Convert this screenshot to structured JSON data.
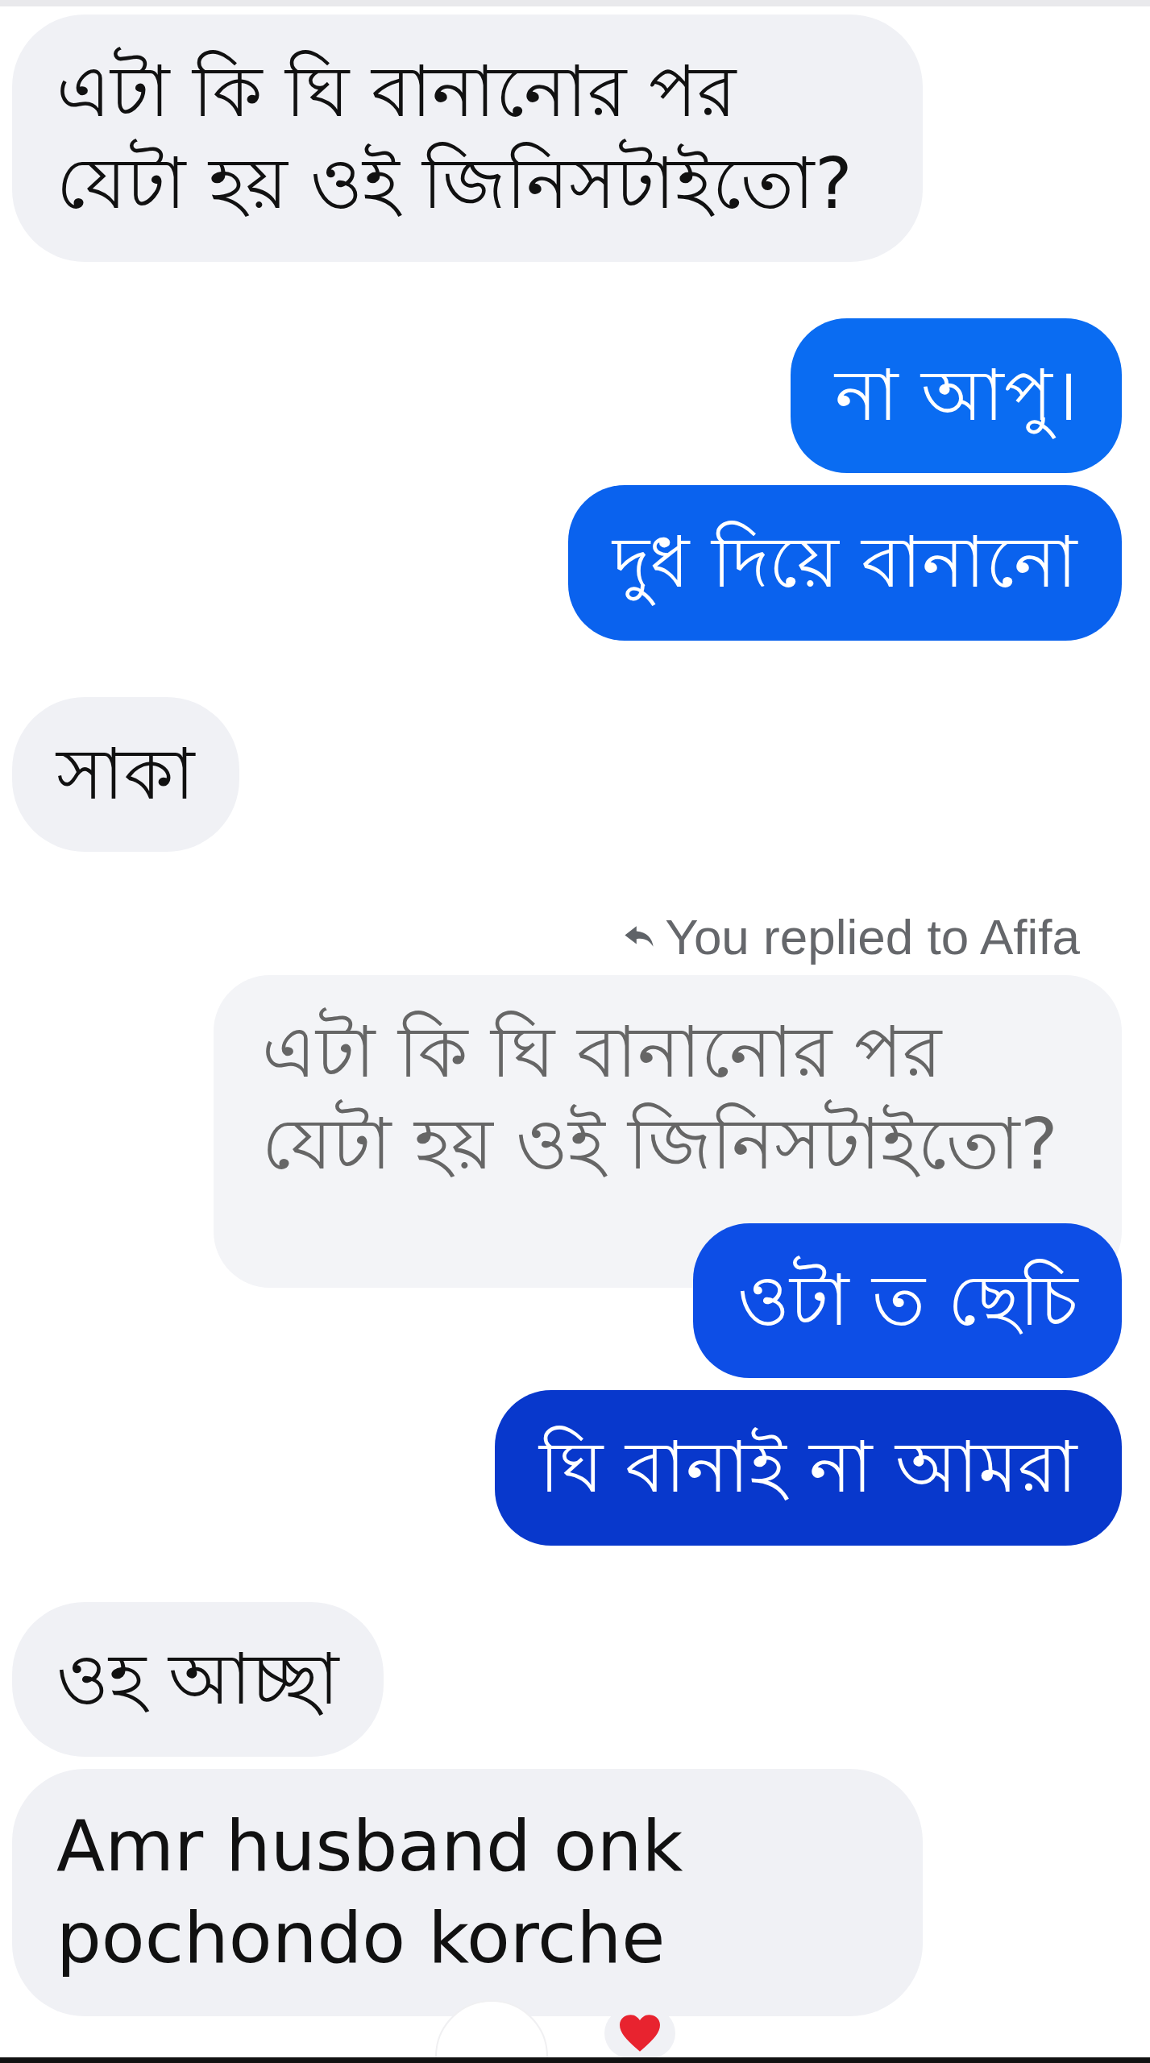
{
  "messages": [
    {
      "kind": "incoming",
      "text": "এটা কি ঘি বানানোর পর যেটা হয় ওই জিনিসটাইতো?"
    },
    {
      "kind": "outgoing",
      "text": "না আপু।",
      "color": "#0a6cf2"
    },
    {
      "kind": "outgoing",
      "text": "দুধ দিয়ে বানানো",
      "color": "#0a62ee"
    },
    {
      "kind": "incoming",
      "text": "সাকা"
    },
    {
      "kind": "reply_label",
      "text": "You replied to Afifa"
    },
    {
      "kind": "quoted",
      "text": "এটা কি ঘি বানানোর পর যেটা হয় ওই জিনিসটাইতো?"
    },
    {
      "kind": "outgoing",
      "text": "ওটা ত ছেচি",
      "color": "#0d4ee6"
    },
    {
      "kind": "outgoing",
      "text": "ঘি বানাই না আমরা",
      "color": "#0838cc"
    },
    {
      "kind": "incoming",
      "text": "ওহ আচ্ছা"
    },
    {
      "kind": "incoming",
      "text": "Amr husband onk pochondo korche"
    }
  ]
}
